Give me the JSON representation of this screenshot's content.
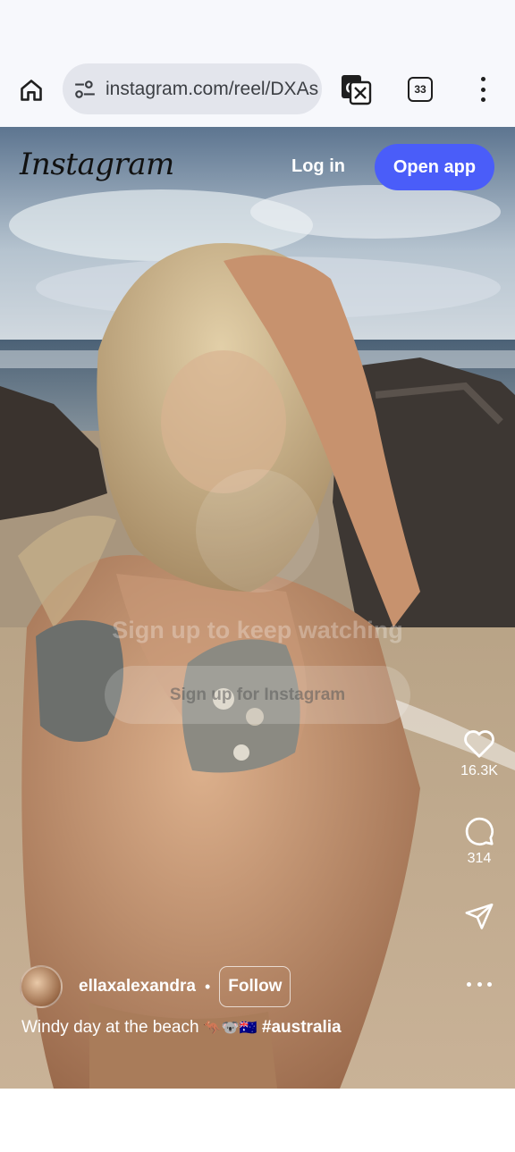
{
  "browser": {
    "url": "instagram.com/reel/DXAs",
    "tab_count": "33",
    "icons": [
      "home-icon",
      "site-settings-icon",
      "translate-icon",
      "tabs-icon",
      "more-vert-icon"
    ]
  },
  "header": {
    "logo_text": "Instagram",
    "login_label": "Log in",
    "open_app_label": "Open app",
    "accent_color": "#4a5df9"
  },
  "overlay": {
    "title": "Sign up to keep watching",
    "signup_label": "Sign up for Instagram"
  },
  "actions": {
    "like_count": "16.3K",
    "comment_count": "314"
  },
  "post": {
    "username": "ellaxalexandra",
    "separator": "•",
    "follow_label": "Follow",
    "caption_text": "Windy day at the beach",
    "caption_emojis": "🦘🐨🇦🇺",
    "hashtag": "#australia"
  }
}
